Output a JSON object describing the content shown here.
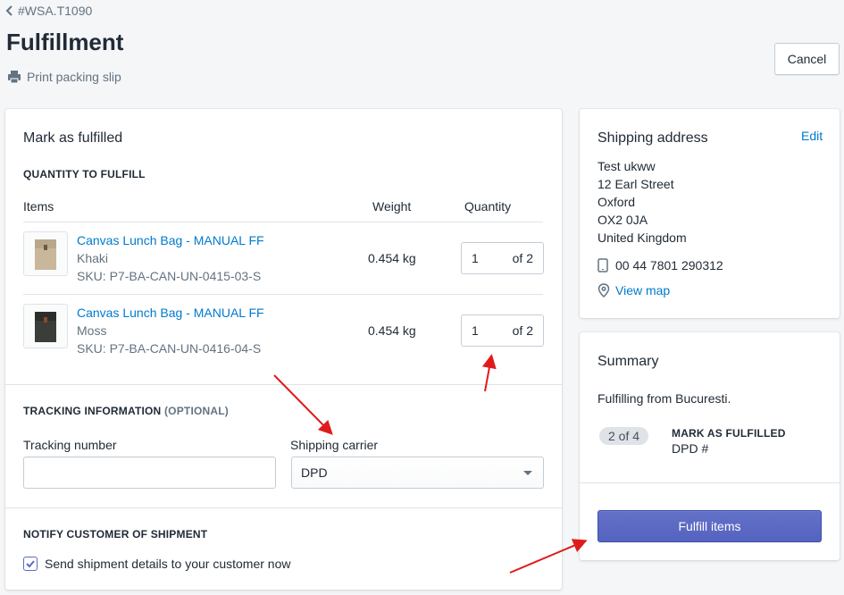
{
  "header": {
    "back_label": "#WSA.T1090",
    "title": "Fulfillment",
    "print_label": "Print packing slip",
    "cancel_label": "Cancel"
  },
  "main": {
    "title": "Mark as fulfilled",
    "quantity_heading": "QUANTITY TO FULFILL",
    "columns": {
      "items": "Items",
      "weight": "Weight",
      "quantity": "Quantity"
    },
    "items": [
      {
        "name": "Canvas Lunch Bag - MANUAL FF",
        "variant": "Khaki",
        "sku": "SKU: P7-BA-CAN-UN-0415-03-S",
        "weight": "0.454 kg",
        "qty": "1",
        "of_total": "of 2",
        "image_color": "#c8b79a"
      },
      {
        "name": "Canvas Lunch Bag - MANUAL FF",
        "variant": "Moss",
        "sku": "SKU: P7-BA-CAN-UN-0416-04-S",
        "weight": "0.454 kg",
        "qty": "1",
        "of_total": "of 2",
        "image_color": "#3a3d38"
      }
    ],
    "tracking_heading": "TRACKING INFORMATION",
    "tracking_optional": "(OPTIONAL)",
    "tracking_number_label": "Tracking number",
    "tracking_number_value": "",
    "carrier_label": "Shipping carrier",
    "carrier_value": "DPD",
    "notify_heading": "NOTIFY CUSTOMER OF SHIPMENT",
    "notify_label": "Send shipment details to your customer now",
    "notify_checked": true
  },
  "address": {
    "title": "Shipping address",
    "edit_label": "Edit",
    "lines": [
      "Test ukww",
      "12 Earl Street",
      "Oxford",
      "OX2 0JA",
      "United Kingdom"
    ],
    "phone": "00 44 7801 290312",
    "map_label": "View map"
  },
  "summary": {
    "title": "Summary",
    "from_text": "Fulfilling from Bucuresti.",
    "badge": "2 of 4",
    "status": "MARK AS FULFILLED",
    "carrier_text": "DPD #",
    "fulfill_label": "Fulfill items"
  },
  "colors": {
    "link": "#007ace",
    "primary": "#5c6ac4",
    "annotation_arrow": "#e01b1b"
  }
}
